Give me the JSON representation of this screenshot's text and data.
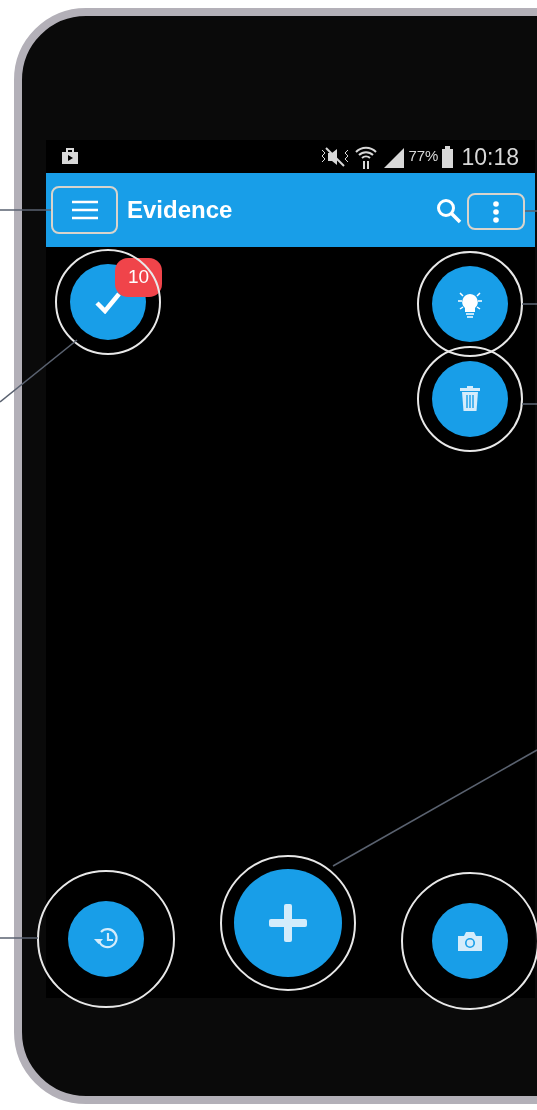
{
  "status_bar": {
    "battery": "77%",
    "time": "10:18"
  },
  "app_bar": {
    "title": "Evidence"
  },
  "fabs": [
    {
      "kind": "check",
      "badge": "10"
    },
    {
      "kind": "bulb"
    },
    {
      "kind": "trash"
    },
    {
      "kind": "history"
    },
    {
      "kind": "add"
    },
    {
      "kind": "camera"
    }
  ]
}
